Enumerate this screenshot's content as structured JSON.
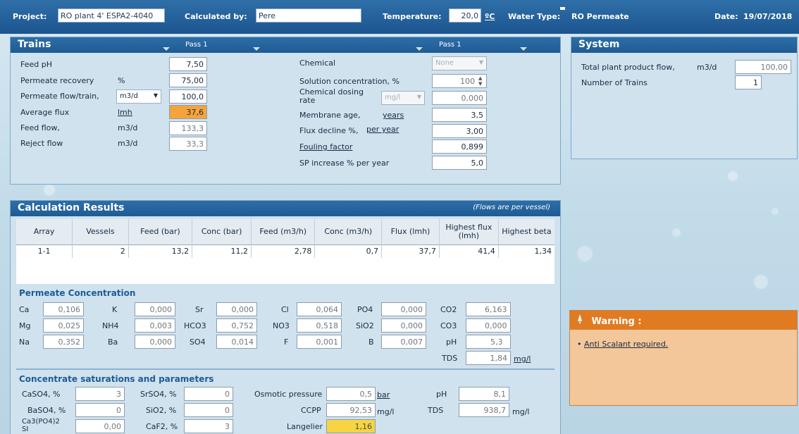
{
  "header": {
    "project_label": "Project:",
    "project_value": "RO plant 4' ESPA2-4040",
    "calculated_by_label": "Calculated by:",
    "calculated_by_value": "Pere",
    "temperature_label": "Temperature:",
    "temperature_value": "20,0",
    "temperature_unit": "ºC",
    "water_type_label": "Water Type:",
    "water_type_value": "RO Permeate",
    "date_label": "Date:",
    "date_value": "19/07/2018"
  },
  "trains": {
    "title": "Trains",
    "pass_label_left": "Pass 1",
    "pass_label_right": "Pass 1",
    "left": [
      {
        "label": "Feed pH",
        "unit": "",
        "value": "7,50"
      },
      {
        "label": "Permeate recovery",
        "unit": "%",
        "value": "75,00"
      },
      {
        "label": "Permeate flow/train,",
        "unit": "m3/d",
        "value": "100,0"
      },
      {
        "label": "Average flux",
        "unit": "lmh",
        "value": "37,6"
      },
      {
        "label": "Feed flow,",
        "unit": "m3/d",
        "value": "133,3"
      },
      {
        "label": "Reject flow",
        "unit": "m3/d",
        "value": "33,3"
      }
    ],
    "right": {
      "chemical_label": "Chemical",
      "chemical_value": "None",
      "solution_label": "Solution concentration, %",
      "solution_value": "100",
      "dosing_label": "Chemical dosing rate",
      "dosing_unit": "mg/l",
      "dosing_value": "0,000",
      "age_label": "Membrane age,",
      "age_unit": "years",
      "age_value": "3,5",
      "flux_decline_label": "Flux decline %,",
      "flux_decline_unit": "per year",
      "flux_decline_value": "3,00",
      "fouling_label": "Fouling factor",
      "fouling_value": "0,899",
      "sp_label": "SP increase % per year",
      "sp_value": "5,0"
    }
  },
  "system": {
    "title": "System",
    "product_flow_label": "Total plant product flow,",
    "product_flow_unit": "m3/d",
    "product_flow_value": "100,00",
    "trains_label": "Number of Trains",
    "trains_value": "1"
  },
  "results": {
    "title": "Calculation Results",
    "note": "(Flows are per vessel)",
    "columns": [
      "Array",
      "Vessels",
      "Feed (bar)",
      "Conc (bar)",
      "Feed (m3/h)",
      "Conc (m3/h)",
      "Flux (lmh)",
      "Highest flux (lmh)",
      "Highest beta"
    ],
    "rows": [
      [
        "1-1",
        "2",
        "13,2",
        "11,2",
        "2,78",
        "0,7",
        "37,7",
        "41,4",
        "1,34"
      ]
    ]
  },
  "permeate": {
    "title": "Permeate Concentration",
    "ions": [
      {
        "label": "Ca",
        "value": "0,106"
      },
      {
        "label": "K",
        "value": "0,000"
      },
      {
        "label": "Sr",
        "value": "0,000"
      },
      {
        "label": "Cl",
        "value": "0,064"
      },
      {
        "label": "PO4",
        "value": "0,000"
      },
      {
        "label": "CO2",
        "value": "6,163"
      },
      {
        "label": "Mg",
        "value": "0,025"
      },
      {
        "label": "NH4",
        "value": "0,003"
      },
      {
        "label": "HCO3",
        "value": "0,752"
      },
      {
        "label": "NO3",
        "value": "0,518"
      },
      {
        "label": "SiO2",
        "value": "0,000"
      },
      {
        "label": "CO3",
        "value": "0,000"
      },
      {
        "label": "Na",
        "value": "0,352"
      },
      {
        "label": "Ba",
        "value": "0,000"
      },
      {
        "label": "SO4",
        "value": "0,014"
      },
      {
        "label": "F",
        "value": "0,001"
      },
      {
        "label": "B",
        "value": "0,007"
      },
      {
        "label": "pH",
        "value": "5,3"
      }
    ],
    "tds_label": "TDS",
    "tds_value": "1,84",
    "tds_unit": "mg/l"
  },
  "concentrate": {
    "title": "Concentrate saturations and parameters",
    "caso4_label": "CaSO4, %",
    "caso4_value": "3",
    "srso4_label": "SrSO4, %",
    "srso4_value": "0",
    "baso4_label": "BaSO4, %",
    "baso4_value": "0",
    "sio2_label": "SiO2, %",
    "sio2_value": "0",
    "ca3po4_label": "Ca3(PO4)2 SI",
    "ca3po4_value": "0,00",
    "caf2_label": "CaF2, %",
    "caf2_value": "3",
    "osmotic_label": "Osmotic pressure",
    "osmotic_value": "0,5",
    "osmotic_unit": "bar",
    "ccpp_label": "CCPP",
    "ccpp_value": "92,53",
    "ccpp_unit": "mg/l",
    "langelier_label": "Langelier",
    "langelier_value": "1,16",
    "ph_label": "pH",
    "ph_value": "8,1",
    "tds_label": "TDS",
    "tds_value": "938,7",
    "tds_unit": "mg/l"
  },
  "warning": {
    "title": "Warning :",
    "message": "Anti Scalant required."
  },
  "colors": {
    "header_blue": "#1f5b94",
    "panel_bg": "#cfe2ee",
    "highlight_orange": "#f5a33c",
    "highlight_yellow": "#f6d442",
    "warning_orange": "#e07b22"
  }
}
